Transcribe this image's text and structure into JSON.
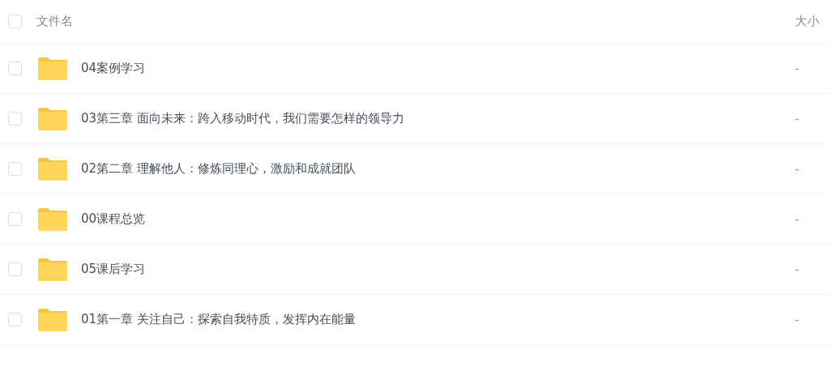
{
  "table": {
    "header": {
      "checked": false,
      "name": "文件名",
      "size": "大小"
    },
    "rows": [
      {
        "kind": "folder",
        "checked": false,
        "name": "04案例学习",
        "size": "-"
      },
      {
        "kind": "folder",
        "checked": false,
        "name": "03第三章 面向未来：跨入移动时代，我们需要怎样的领导力",
        "size": "-"
      },
      {
        "kind": "folder",
        "checked": false,
        "name": "02第二章 理解他人：修炼同理心，激励和成就团队",
        "size": "-"
      },
      {
        "kind": "folder",
        "checked": false,
        "name": "00课程总览",
        "size": "-"
      },
      {
        "kind": "folder",
        "checked": false,
        "name": "05课后学习",
        "size": "-"
      },
      {
        "kind": "folder",
        "checked": false,
        "name": "01第一章 关注自己：探索自我特质，发挥内在能量",
        "size": "-"
      }
    ]
  }
}
